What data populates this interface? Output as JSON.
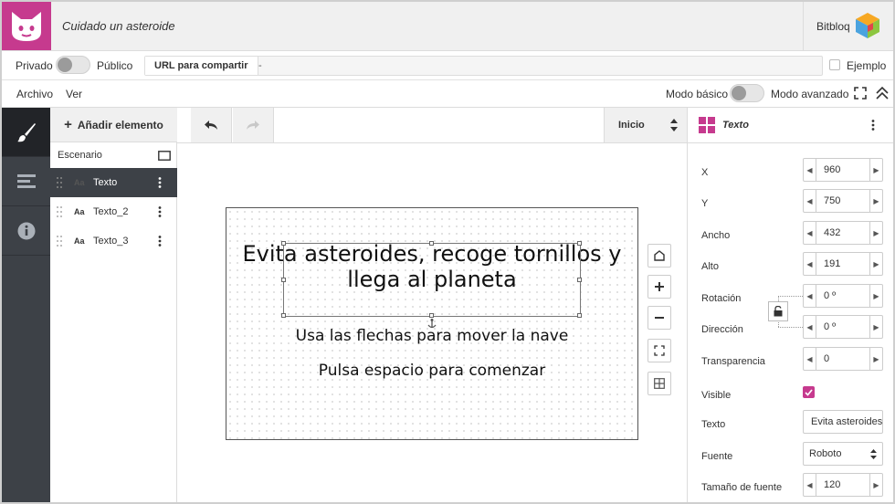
{
  "header": {
    "project_title": "Cuidado un asteroide",
    "brand": "Bitbloq",
    "accent": "#c63a8e"
  },
  "share": {
    "private_label": "Privado",
    "public_label": "Público",
    "url_label": "URL para compartir",
    "url_value": "-",
    "example_label": "Ejemplo"
  },
  "menu": {
    "file": "Archivo",
    "view": "Ver",
    "basic_mode": "Modo básico",
    "advanced_mode": "Modo avanzado"
  },
  "elements": {
    "add_label": "Añadir elemento",
    "scene_label": "Escenario",
    "items": [
      {
        "name": "Texto",
        "icon": "Aa",
        "selected": true
      },
      {
        "name": "Texto_2",
        "icon": "Aa",
        "selected": false
      },
      {
        "name": "Texto_3",
        "icon": "Aa",
        "selected": false
      }
    ]
  },
  "toolbar": {
    "scene_select": "Inicio"
  },
  "canvas": {
    "main_text": "Evita asteroides, recoge tornillos y llega al planeta",
    "sub_text_1": "Usa las flechas para mover la nave",
    "sub_text_2": "Pulsa espacio para comenzar"
  },
  "properties": {
    "title": "Texto",
    "x_label": "X",
    "x": "960",
    "y_label": "Y",
    "y": "750",
    "width_label": "Ancho",
    "width": "432",
    "height_label": "Alto",
    "height": "191",
    "rotation_label": "Rotación",
    "rotation": "0 º",
    "direction_label": "Dirección",
    "direction": "0 º",
    "transparency_label": "Transparencia",
    "transparency": "0",
    "visible_label": "Visible",
    "text_label": "Texto",
    "text": "Evita asteroides, recoge tornillos y llega al planeta",
    "font_label": "Fuente",
    "font": "Roboto",
    "font_size_label": "Tamaño de fuente",
    "font_size": "120"
  }
}
